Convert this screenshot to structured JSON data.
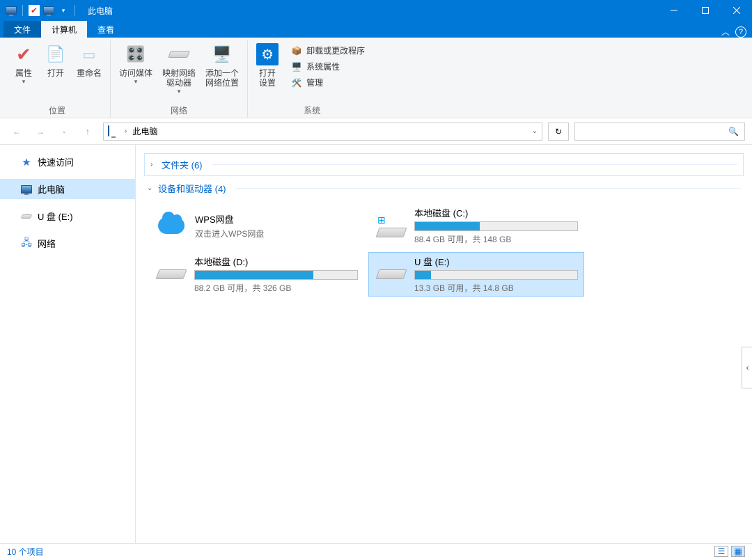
{
  "titlebar": {
    "title": "此电脑"
  },
  "tabs": {
    "file": "文件",
    "computer": "计算机",
    "view": "查看"
  },
  "ribbon": {
    "location": {
      "properties": "属性",
      "open": "打开",
      "rename": "重命名",
      "group_label": "位置"
    },
    "network": {
      "access_media": "访问媒体",
      "map_drive": "映射网络\n驱动器",
      "add_location": "添加一个\n网络位置",
      "group_label": "网络"
    },
    "system": {
      "open_settings": "打开\n设置",
      "uninstall": "卸载或更改程序",
      "sys_props": "系统属性",
      "manage": "管理",
      "group_label": "系统"
    }
  },
  "breadcrumb": {
    "root": "此电脑"
  },
  "sidebar": {
    "quick_access": "快速访问",
    "this_pc": "此电脑",
    "usb": "U 盘 (E:)",
    "network": "网络"
  },
  "groups": {
    "folders": "文件夹 (6)",
    "devices": "设备和驱动器 (4)"
  },
  "drives": [
    {
      "title": "WPS网盘",
      "sub": "双击进入WPS网盘",
      "type": "cloud",
      "fill": 0
    },
    {
      "title": "本地磁盘 (C:)",
      "sub": "88.4 GB 可用，共 148 GB",
      "type": "disk",
      "fill": 40,
      "winlogo": true
    },
    {
      "title": "本地磁盘 (D:)",
      "sub": "88.2 GB 可用，共 326 GB",
      "type": "disk",
      "fill": 73
    },
    {
      "title": "U 盘 (E:)",
      "sub": "13.3 GB 可用，共 14.8 GB",
      "type": "disk",
      "fill": 10,
      "selected": true
    }
  ],
  "statusbar": {
    "count": "10 个项目"
  }
}
